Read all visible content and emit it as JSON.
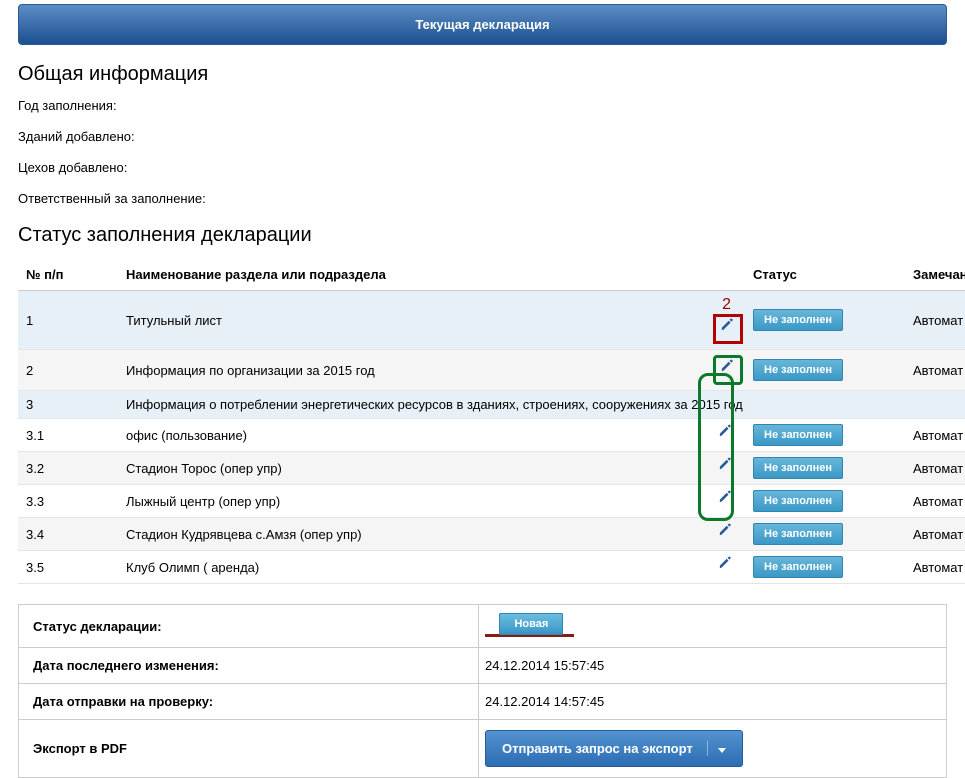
{
  "header": {
    "title": "Текущая декларация"
  },
  "general_info": {
    "title": "Общая информация",
    "rows": [
      {
        "label": "Год заполнения:"
      },
      {
        "label": "Зданий добавлено:"
      },
      {
        "label": "Цехов добавлено:"
      },
      {
        "label": "Ответственный за заполнение:"
      }
    ]
  },
  "status_section": {
    "title": "Статус заполнения декларации",
    "columns": {
      "num": "№ п/п",
      "name": "Наименование раздела или подраздела",
      "status": "Статус",
      "note": "Замечан"
    },
    "badge_not_filled": "Не заполнен",
    "note_auto": "Автомат",
    "annotation_2": "2",
    "rows": [
      {
        "num": "1",
        "name": "Титульный лист",
        "edit": true,
        "status": "badge",
        "note": true,
        "annot": "red"
      },
      {
        "num": "2",
        "name": "Информация по организации за 2015 год",
        "edit": true,
        "status": "badge",
        "note": true,
        "annot": "green_single"
      },
      {
        "num": "3",
        "name": "Информация о потреблении энергетических ресурсов в зданиях, строениях, сооружениях за 2015 год",
        "edit": false,
        "status": "none",
        "note": false
      },
      {
        "num": "3.1",
        "name": "офис (пользование)",
        "edit": true,
        "status": "badge",
        "note": true
      },
      {
        "num": "3.2",
        "name": "Стадион Торос (опер упр)",
        "edit": true,
        "status": "badge",
        "note": true
      },
      {
        "num": "3.3",
        "name": "Лыжный центр (опер упр)",
        "edit": true,
        "status": "badge",
        "note": true
      },
      {
        "num": "3.4",
        "name": "Стадион Кудрявцева с.Амзя (опер упр)",
        "edit": true,
        "status": "badge",
        "note": true
      },
      {
        "num": "3.5",
        "name": "Клуб Олимп ( аренда)",
        "edit": true,
        "status": "badge",
        "note": true
      }
    ]
  },
  "summary": {
    "rows": [
      {
        "label": "Статус декларации:",
        "type": "badge_new",
        "value": "Новая"
      },
      {
        "label": "Дата последнего изменения:",
        "type": "text",
        "value": "24.12.2014 15:57:45"
      },
      {
        "label": "Дата отправки на проверку:",
        "type": "text",
        "value": "24.12.2014 14:57:45"
      },
      {
        "label": "Экспорт в PDF",
        "type": "export_button",
        "value": "Отправить запрос на экспорт"
      }
    ]
  }
}
